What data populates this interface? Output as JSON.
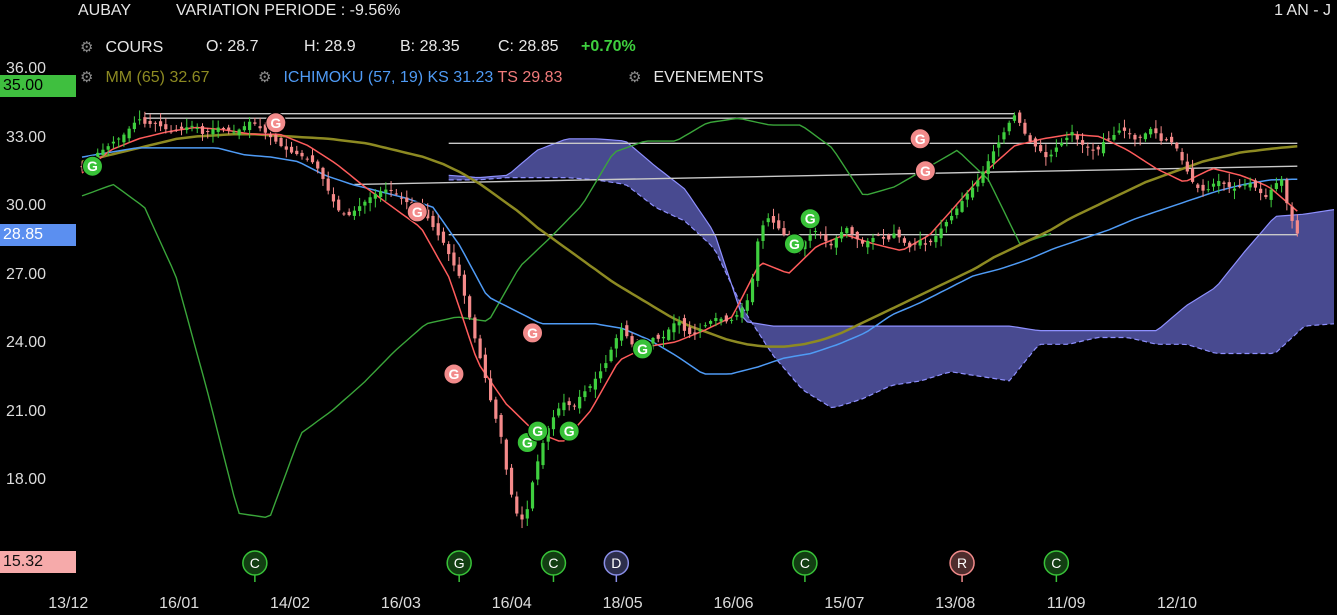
{
  "header": {
    "symbol": "AUBAY",
    "variation": "VARIATION PERIODE : -9.56%",
    "period": "1 AN - J"
  },
  "legend": {
    "cours": {
      "label": "COURS",
      "o": "O: 28.7",
      "h": "H: 28.9",
      "b": "B: 28.35",
      "c": "C: 28.85",
      "chg": "+0.70%"
    },
    "mm": {
      "label": "MM (65)",
      "value": "32.67"
    },
    "ichimoku": {
      "label": "ICHIMOKU (57, 19)",
      "ks": "KS 31.23",
      "ts": "TS 29.83"
    },
    "events": {
      "label": "EVENEMENTS"
    }
  },
  "icons": [
    "gear-icon",
    "g-event-icon",
    "c-event-icon",
    "d-event-icon",
    "r-event-icon"
  ],
  "colors": {
    "bg": "#000000",
    "up": "#3fcf3f",
    "down": "#f58a8a",
    "mm": "#8d8a22",
    "ks": "#4f9bf5",
    "ts": "#ff5c5c",
    "chikou": "#3aa63a",
    "cloud": "#6466c8",
    "line": "#c9c9c9"
  },
  "y_badges": {
    "ma": "35.00",
    "price": "28.85",
    "low": "15.32"
  },
  "chart_data": {
    "type": "line",
    "ylim": [
      14.6,
      36.8
    ],
    "x_ticks": [
      "13/12",
      "16/01",
      "14/02",
      "16/03",
      "16/04",
      "18/05",
      "16/06",
      "15/07",
      "13/08",
      "11/09",
      "12/10"
    ],
    "y_ticks": [
      "36.00",
      "33.00",
      "30.00",
      "27.00",
      "24.00",
      "21.00",
      "18.00"
    ],
    "y_tick_values": [
      36,
      33,
      30,
      27,
      24,
      21,
      18
    ],
    "x_tick_index": [
      8,
      29,
      50,
      71,
      92,
      113,
      134,
      155,
      176,
      197,
      218
    ],
    "series": [
      {
        "key": "close",
        "values": [
          31.8,
          32.1,
          32.4,
          32.6,
          32.9,
          33.1,
          33.5,
          33.9,
          33.6,
          33.7,
          33.5,
          33.3,
          33.4,
          33.5,
          33.6,
          33.2,
          33.4,
          33.5,
          33.4,
          33.3,
          33.5,
          33.8,
          33.5,
          33.2,
          32.9,
          32.6,
          32.4,
          32.3,
          32.1,
          31.9,
          31.2,
          30.4,
          29.8,
          29.6,
          29.9,
          30.2,
          30.5,
          30.7,
          30.8,
          30.6,
          30.3,
          30.1,
          29.9,
          29.5,
          28.9,
          28.4,
          27.6,
          26.9,
          25.4,
          24.0,
          22.7,
          21.2,
          20.1,
          17.9,
          16.6,
          16.2,
          18.0,
          19.4,
          20.4,
          21.1,
          21.5,
          21.2,
          21.8,
          22.1,
          22.6,
          23.1,
          24.0,
          24.7,
          24.2,
          23.6,
          23.9,
          24.3,
          24.2,
          24.7,
          25.1,
          24.5,
          24.4,
          24.7,
          25.0,
          25.2,
          25.0,
          25.1,
          25.6,
          26.1,
          28.6,
          29.6,
          29.3,
          28.9,
          28.4,
          28.1,
          28.6,
          29.0,
          28.7,
          28.3,
          28.8,
          29.1,
          28.7,
          28.4,
          28.6,
          28.8,
          28.5,
          28.9,
          28.5,
          28.2,
          28.6,
          28.3,
          28.7,
          29.2,
          29.6,
          30.1,
          30.6,
          31.0,
          31.6,
          32.3,
          32.9,
          33.6,
          34.1,
          33.3,
          32.8,
          32.5,
          32.1,
          32.6,
          32.9,
          33.3,
          32.8,
          32.6,
          32.4,
          32.9,
          33.1,
          33.4,
          33.3,
          32.9,
          33.2,
          33.5,
          32.9,
          33.0,
          32.6,
          31.8,
          31.1,
          30.7,
          30.8,
          31.2,
          31.0,
          30.8,
          30.9,
          31.1,
          30.8,
          30.4,
          30.9,
          31.3,
          29.7,
          28.85
        ]
      },
      {
        "key": "mm65",
        "values": [
          32.0,
          32.2,
          32.4,
          32.6,
          32.8,
          33.0,
          33.1,
          33.15,
          33.2,
          33.2,
          33.15,
          33.1,
          33.05,
          33.0,
          32.9,
          32.8,
          32.6,
          32.4,
          32.2,
          31.9,
          31.5,
          31.0,
          30.4,
          29.8,
          29.1,
          28.5,
          27.9,
          27.3,
          26.7,
          26.2,
          25.7,
          25.2,
          24.8,
          24.5,
          24.2,
          24.0,
          23.9,
          23.9,
          24.0,
          24.2,
          24.5,
          24.9,
          25.3,
          25.7,
          26.1,
          26.5,
          26.9,
          27.3,
          27.8,
          28.2,
          28.6,
          29.0,
          29.5,
          29.9,
          30.3,
          30.7,
          31.1,
          31.4,
          31.7,
          32.0,
          32.2,
          32.4,
          32.5,
          32.6,
          32.67
        ]
      },
      {
        "key": "kijun",
        "values": [
          32.2,
          32.4,
          32.6,
          32.6,
          32.6,
          32.6,
          32.3,
          32.2,
          32.0,
          31.4,
          31.0,
          30.7,
          30.4,
          30.0,
          28.3,
          26.1,
          25.5,
          24.9,
          24.9,
          24.9,
          24.7,
          24.2,
          23.5,
          22.7,
          22.7,
          23.0,
          23.4,
          23.6,
          24.0,
          24.5,
          25.3,
          25.8,
          26.4,
          27.0,
          27.3,
          27.7,
          28.2,
          28.6,
          29.0,
          29.5,
          29.9,
          30.3,
          30.7,
          31.0,
          31.2,
          31.23
        ]
      },
      {
        "key": "tenkan",
        "values": [
          31.5,
          32.5,
          33.0,
          33.3,
          33.5,
          33.4,
          33.2,
          33.2,
          32.7,
          31.9,
          30.9,
          30.0,
          29.1,
          26.9,
          23.2,
          21.4,
          20.2,
          19.7,
          21.1,
          23.3,
          23.9,
          24.1,
          24.6,
          25.2,
          27.6,
          27.1,
          28.3,
          28.8,
          28.4,
          28.1,
          28.8,
          30.2,
          31.6,
          32.7,
          33.0,
          33.2,
          33.1,
          32.5,
          31.7,
          31.1,
          31.7,
          31.4,
          30.9,
          29.83
        ]
      },
      {
        "key": "chikou",
        "values": [
          30.5,
          31.0,
          30.0,
          27.0,
          22.0,
          16.6,
          16.4,
          20.1,
          21.1,
          22.3,
          23.7,
          24.9,
          25.2,
          25.0,
          27.4,
          28.7,
          30.1,
          32.4,
          32.9,
          32.9,
          33.7,
          33.9,
          33.6,
          33.6,
          32.6,
          30.5,
          30.9,
          31.7,
          32.5,
          31.2,
          28.4,
          28.85
        ]
      },
      {
        "key": "cloud_upper",
        "values": [
          31.4,
          31.3,
          31.4,
          32.5,
          33.0,
          33.0,
          32.9,
          31.8,
          30.8,
          28.9,
          25.0,
          24.8,
          24.8,
          24.8,
          24.8,
          24.8,
          24.8,
          24.8,
          24.8,
          24.8,
          24.6,
          24.6,
          24.6,
          24.6,
          24.6,
          25.7,
          26.5,
          28.1,
          29.6,
          29.7,
          29.9
        ]
      },
      {
        "key": "cloud_lower",
        "values": [
          31.2,
          31.2,
          31.3,
          31.3,
          31.3,
          31.2,
          31.0,
          30.0,
          29.4,
          28.2,
          25.5,
          23.5,
          22.0,
          21.2,
          21.6,
          22.2,
          22.4,
          22.8,
          22.6,
          22.4,
          24.0,
          24.0,
          24.3,
          24.3,
          24.0,
          24.0,
          23.6,
          23.6,
          23.6,
          24.8,
          24.9
        ]
      },
      {
        "key": "h_lines",
        "values": [
          34.1,
          33.9,
          32.8,
          31.0,
          28.8
        ]
      }
    ],
    "events_on_chart": [
      {
        "idx": 2,
        "y": 31.8,
        "type": "G",
        "color": "green"
      },
      {
        "idx": 37,
        "y": 33.7,
        "type": "G",
        "color": "red"
      },
      {
        "idx": 64,
        "y": 29.8,
        "type": "G",
        "color": "red"
      },
      {
        "idx": 71,
        "y": 22.7,
        "type": "G",
        "color": "red"
      },
      {
        "idx": 85,
        "y": 19.7,
        "type": "G",
        "color": "green"
      },
      {
        "idx": 86,
        "y": 24.5,
        "type": "G",
        "color": "red"
      },
      {
        "idx": 87,
        "y": 20.2,
        "type": "G",
        "color": "green"
      },
      {
        "idx": 93,
        "y": 20.2,
        "type": "G",
        "color": "green"
      },
      {
        "idx": 107,
        "y": 23.8,
        "type": "G",
        "color": "green"
      },
      {
        "idx": 136,
        "y": 28.4,
        "type": "G",
        "color": "green"
      },
      {
        "idx": 139,
        "y": 29.5,
        "type": "G",
        "color": "green"
      },
      {
        "idx": 160,
        "y": 33.0,
        "type": "G",
        "color": "red"
      },
      {
        "idx": 161,
        "y": 31.6,
        "type": "G",
        "color": "red"
      }
    ],
    "events_bottom": [
      {
        "idx": 33,
        "type": "C",
        "color": "green"
      },
      {
        "idx": 72,
        "type": "G",
        "color": "green"
      },
      {
        "idx": 90,
        "type": "C",
        "color": "green"
      },
      {
        "idx": 102,
        "type": "D",
        "color": "blue"
      },
      {
        "idx": 138,
        "type": "C",
        "color": "green"
      },
      {
        "idx": 168,
        "type": "R",
        "color": "red"
      },
      {
        "idx": 186,
        "type": "C",
        "color": "green"
      }
    ]
  }
}
